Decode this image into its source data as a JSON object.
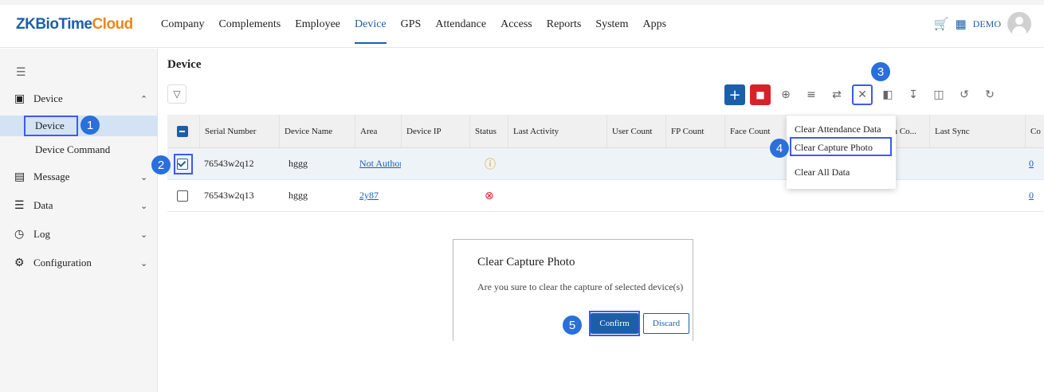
{
  "app": {
    "logo_main": "ZKBioTime",
    "logo_accent": "Cloud"
  },
  "nav": {
    "items": [
      "Company",
      "Complements",
      "Employee",
      "Device",
      "GPS",
      "Attendance",
      "Access",
      "Reports",
      "System",
      "Apps"
    ],
    "active": "Device",
    "user_label": "DEMO"
  },
  "sidebar": {
    "device_group": "Device",
    "device_item": "Device",
    "device_command": "Device Command",
    "message": "Message",
    "data": "Data",
    "log": "Log",
    "configuration": "Configuration"
  },
  "page": {
    "title": "Device"
  },
  "table": {
    "headers": [
      "Serial Number",
      "Device Name",
      "Area",
      "Device IP",
      "Status",
      "Last Activity",
      "User Count",
      "FP Count",
      "Face Count",
      "on Co...",
      "Last Sync",
      "Co"
    ],
    "rows": [
      {
        "serial": "76543w2q12",
        "name": "hggg",
        "area": "Not Authoriz",
        "status": "warning",
        "last_col": "0"
      },
      {
        "serial": "76543w2q13",
        "name": "hggg",
        "area": "2y87",
        "status": "error",
        "last_col": "0"
      }
    ]
  },
  "dropdown": {
    "items": [
      "Clear Attendance Data",
      "Clear Capture Photo",
      "Clear All Data"
    ]
  },
  "dialog": {
    "title": "Clear Capture Photo",
    "message": "Are you sure to clear the capture of selected device(s)",
    "confirm": "Confirm",
    "discard": "Discard"
  },
  "steps": [
    "1",
    "2",
    "3",
    "4",
    "5"
  ],
  "colors": {
    "brand": "#1c5fa8",
    "accent": "#e8891d",
    "danger": "#d6222a",
    "highlight": "#3d5af1",
    "step_marker": "#2a6fdb"
  }
}
